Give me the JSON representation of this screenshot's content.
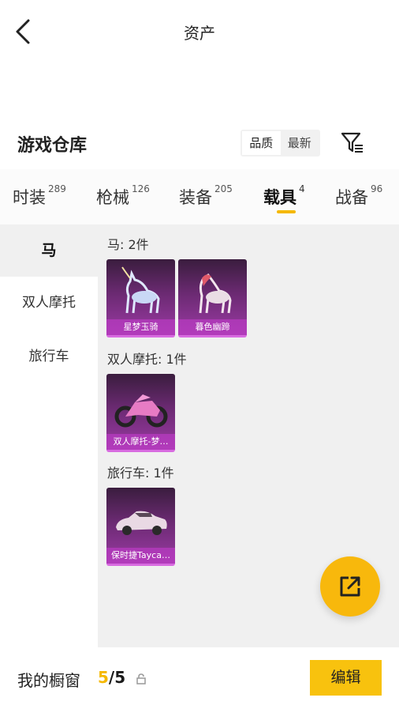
{
  "header": {
    "title": "资产"
  },
  "section": {
    "title": "游戏仓库",
    "sort": [
      "品质",
      "最新"
    ]
  },
  "tabs": [
    {
      "label": "时装",
      "count": "289"
    },
    {
      "label": "枪械",
      "count": "126"
    },
    {
      "label": "装备",
      "count": "205"
    },
    {
      "label": "载具",
      "count": "4"
    },
    {
      "label": "战备",
      "count": "96"
    }
  ],
  "side_menu": [
    "马",
    "双人摩托",
    "旅行车"
  ],
  "groups": [
    {
      "label": "马: 2件",
      "items": [
        "星梦玉骑",
        "暮色幽蹄"
      ]
    },
    {
      "label": "双人摩托: 1件",
      "items": [
        "双人摩托-梦…"
      ]
    },
    {
      "label": "旅行车: 1件",
      "items": [
        "保时捷Tayca…"
      ]
    }
  ],
  "bottom": {
    "label": "我的橱窗",
    "current": "5",
    "sep_total": "/5",
    "edit": "编辑"
  },
  "colors": {
    "accent": "#f8c20e",
    "card": "#6b2a72"
  },
  "icons": [
    "back-arrow-icon",
    "filter-icon",
    "share-icon",
    "lock-icon"
  ]
}
